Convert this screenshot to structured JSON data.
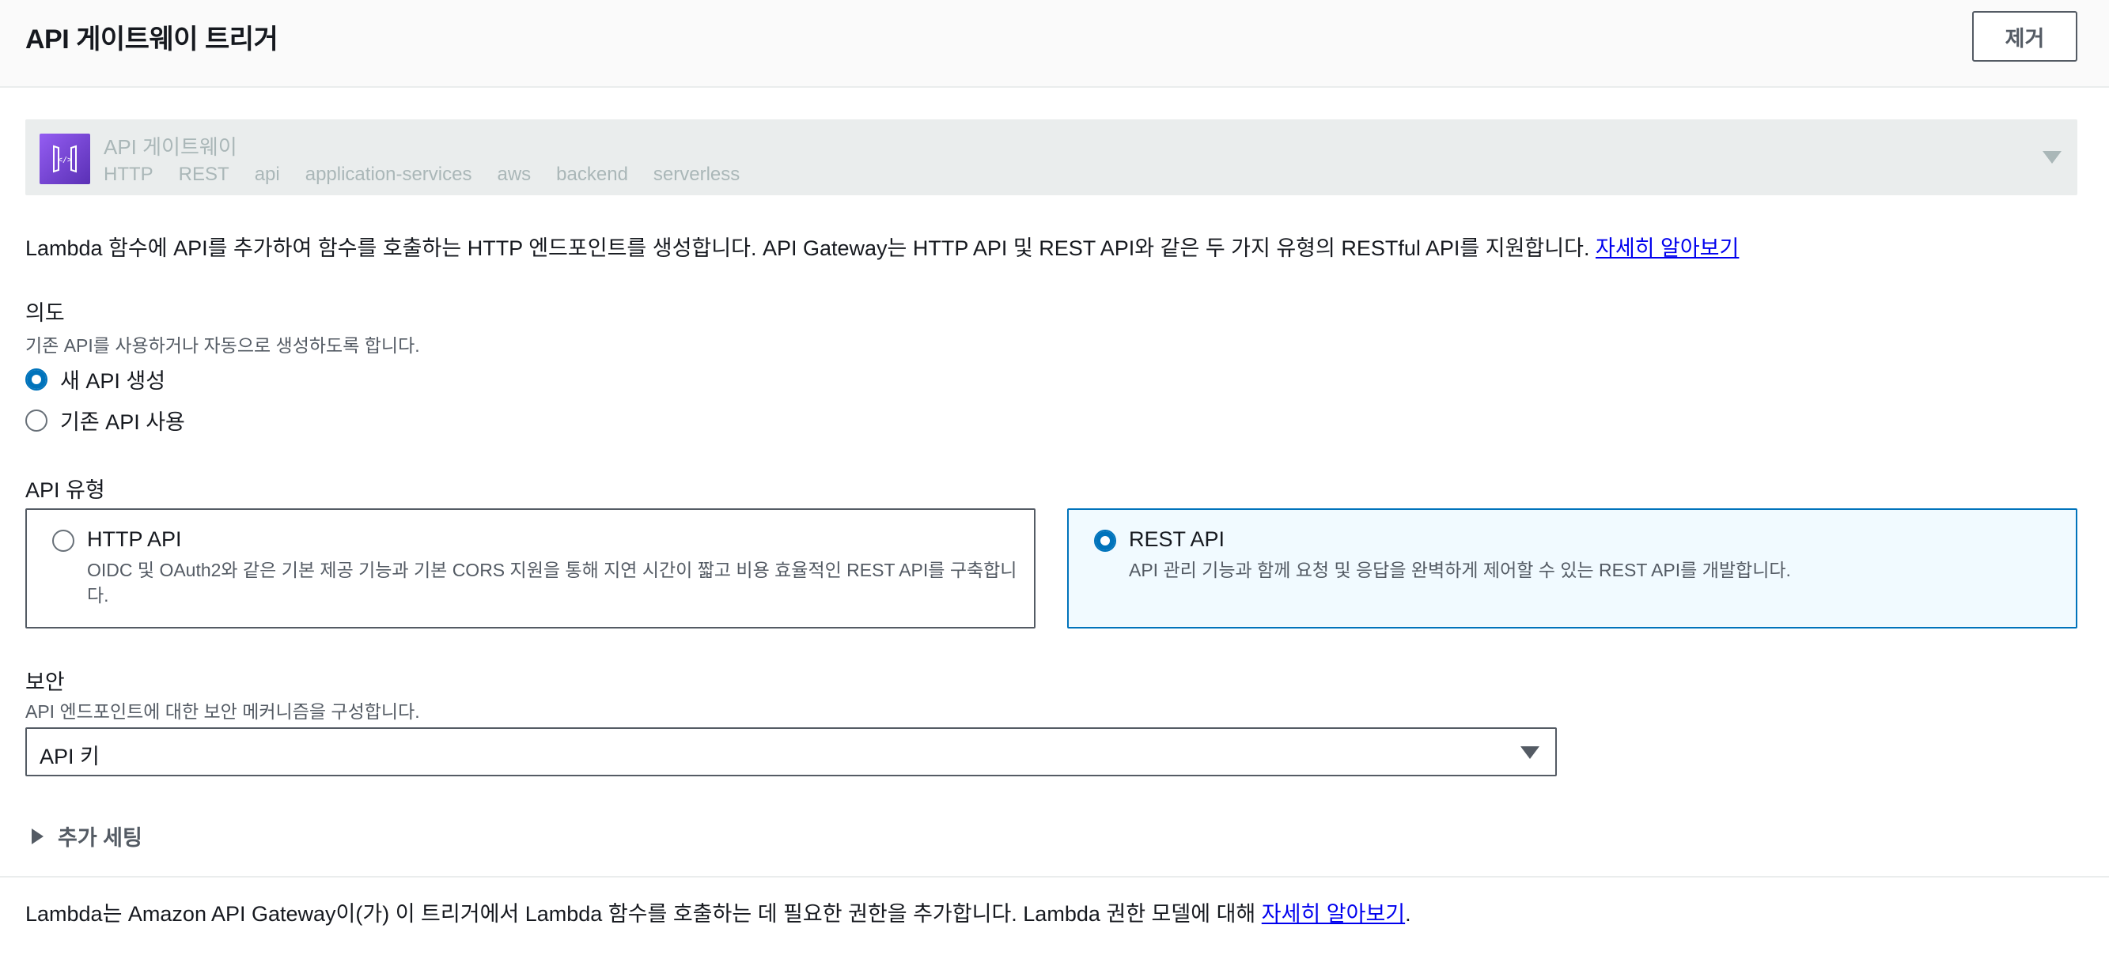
{
  "header": {
    "title": "API 게이트웨이 트리거",
    "remove_label": "제거"
  },
  "service": {
    "name": "API 게이트웨이",
    "tags": [
      "HTTP",
      "REST",
      "api",
      "application-services",
      "aws",
      "backend",
      "serverless"
    ],
    "icon": "api-gateway-logo"
  },
  "description": {
    "text": "Lambda 함수에 API를 추가하여 함수를 호출하는 HTTP 엔드포인트를 생성합니다. API Gateway는 HTTP API 및 REST API와 같은 두 가지 유형의 RESTful API를 지원합니다.",
    "link": "자세히 알아보기"
  },
  "intent": {
    "label": "의도",
    "hint": "기존 API를 사용하거나 자동으로 생성하도록 합니다.",
    "options": [
      {
        "label": "새 API 생성",
        "selected": true
      },
      {
        "label": "기존 API 사용",
        "selected": false
      }
    ]
  },
  "api_type": {
    "label": "API 유형",
    "options": [
      {
        "title": "HTTP API",
        "desc_line1": "OIDC 및 OAuth2와 같은 기본 제공 기능과 기본 CORS 지원을 통해 지연 시간이 짧고 비용 효율적인 REST API를 구축합니",
        "desc_line2": "다.",
        "selected": false
      },
      {
        "title": "REST API",
        "desc_line1": "API 관리 기능과 함께 요청 및 응답을 완벽하게 제어할 수 있는 REST API를 개발합니다.",
        "selected": true
      }
    ]
  },
  "security": {
    "label": "보안",
    "hint": "API 엔드포인트에 대한 보안 메커니즘을 구성합니다.",
    "value": "API 키"
  },
  "additional": {
    "label": "추가 세팅"
  },
  "footer": {
    "text": "Lambda는 Amazon API Gateway이(가) 이 트리거에서 Lambda 함수를 호출하는 데 필요한 권한을 추가합니다. Lambda 권한 모델에 대해 ",
    "link": "자세히 알아보기",
    "end": "."
  },
  "colors": {
    "accent": "#0073bb",
    "selected_bg": "#f1faff",
    "logo_purple": "#7b46d6"
  }
}
